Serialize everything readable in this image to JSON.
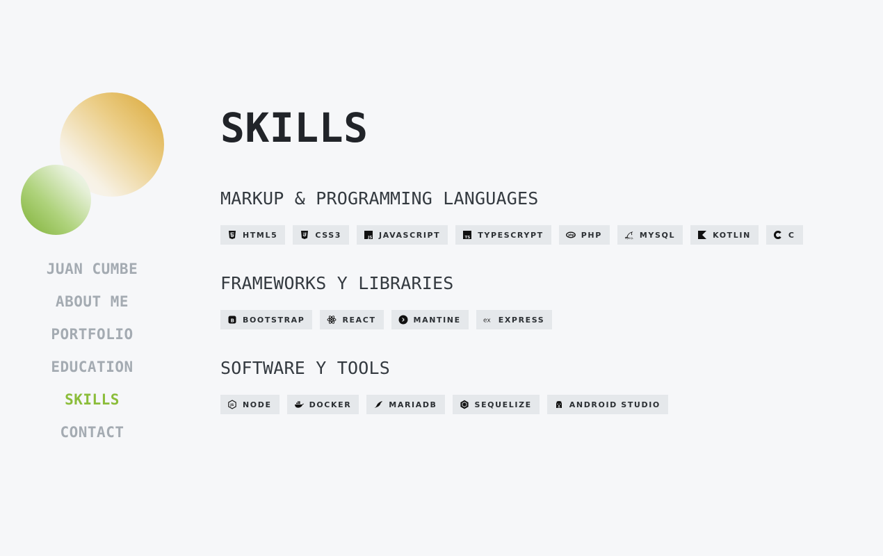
{
  "sidebar": {
    "nav": [
      {
        "label": "JUAN CUMBE",
        "active": false
      },
      {
        "label": "ABOUT ME",
        "active": false
      },
      {
        "label": "PORTFOLIO",
        "active": false
      },
      {
        "label": "EDUCATION",
        "active": false
      },
      {
        "label": "SKILLS",
        "active": true
      },
      {
        "label": "CONTACT",
        "active": false
      }
    ],
    "colors": {
      "inactive": "#a4abb2",
      "active": "#8bbd3a",
      "logo_gold": "#d9a634",
      "logo_green": "#7fb036"
    }
  },
  "main": {
    "title": "SKILLS",
    "sections": [
      {
        "title": "MARKUP & PROGRAMMING LANGUAGES",
        "chips": [
          {
            "label": "HTML5",
            "icon": "html5-icon"
          },
          {
            "label": "CSS3",
            "icon": "css3-icon"
          },
          {
            "label": "JAVASCRIPT",
            "icon": "javascript-icon"
          },
          {
            "label": "TYPESCRYPT",
            "icon": "typescript-icon"
          },
          {
            "label": "PHP",
            "icon": "php-icon"
          },
          {
            "label": "MYSQL",
            "icon": "mysql-icon"
          },
          {
            "label": "KOTLIN",
            "icon": "kotlin-icon"
          },
          {
            "label": "C",
            "icon": "c-icon"
          }
        ]
      },
      {
        "title": "FRAMEWORKS Y LIBRARIES",
        "chips": [
          {
            "label": "BOOTSTRAP",
            "icon": "bootstrap-icon"
          },
          {
            "label": "REACT",
            "icon": "react-icon"
          },
          {
            "label": "MANTINE",
            "icon": "mantine-icon"
          },
          {
            "label": "EXPRESS",
            "icon": "express-icon"
          }
        ]
      },
      {
        "title": "SOFTWARE Y TOOLS",
        "chips": [
          {
            "label": "NODE",
            "icon": "nodejs-icon"
          },
          {
            "label": "DOCKER",
            "icon": "docker-icon"
          },
          {
            "label": "MARIADB",
            "icon": "mariadb-icon"
          },
          {
            "label": "SEQUELIZE",
            "icon": "sequelize-icon"
          },
          {
            "label": "ANDROID STUDIO",
            "icon": "android-studio-icon"
          }
        ]
      }
    ]
  }
}
